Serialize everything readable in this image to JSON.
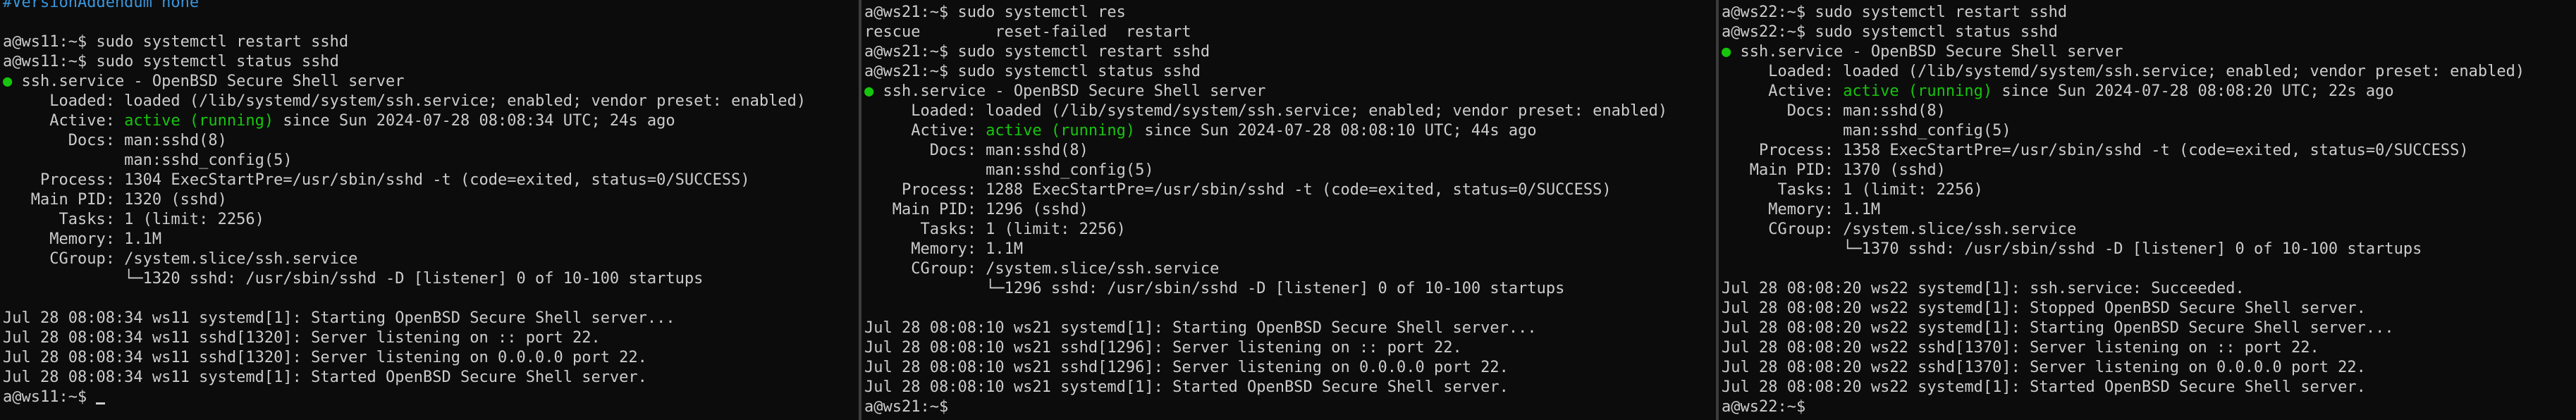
{
  "panes": [
    {
      "host": "ws11",
      "lines": [
        {
          "text": "#VersionAddendum none",
          "color": "cyan"
        },
        {
          "text": ""
        },
        {
          "text": "a@ws11:~$ sudo systemctl restart sshd"
        },
        {
          "text": "a@ws11:~$ sudo systemctl status sshd"
        },
        {
          "bullet": "●",
          "text": " ssh.service - OpenBSD Secure Shell server"
        },
        {
          "text": "     Loaded: loaded (/lib/systemd/system/ssh.service; enabled; vendor preset: enabled)"
        },
        {
          "pre": "     Active: ",
          "hl": "active (running)",
          "post": " since Sun 2024-07-28 08:08:34 UTC; 24s ago"
        },
        {
          "text": "       Docs: man:sshd(8)"
        },
        {
          "text": "             man:sshd_config(5)"
        },
        {
          "text": "    Process: 1304 ExecStartPre=/usr/sbin/sshd -t (code=exited, status=0/SUCCESS)"
        },
        {
          "text": "   Main PID: 1320 (sshd)"
        },
        {
          "text": "      Tasks: 1 (limit: 2256)"
        },
        {
          "text": "     Memory: 1.1M"
        },
        {
          "text": "     CGroup: /system.slice/ssh.service"
        },
        {
          "text": "             └─1320 sshd: /usr/sbin/sshd -D [listener] 0 of 10-100 startups"
        },
        {
          "text": ""
        },
        {
          "text": "Jul 28 08:08:34 ws11 systemd[1]: Starting OpenBSD Secure Shell server..."
        },
        {
          "text": "Jul 28 08:08:34 ws11 sshd[1320]: Server listening on :: port 22."
        },
        {
          "text": "Jul 28 08:08:34 ws11 sshd[1320]: Server listening on 0.0.0.0 port 22."
        },
        {
          "text": "Jul 28 08:08:34 ws11 systemd[1]: Started OpenBSD Secure Shell server."
        },
        {
          "text": "a@ws11:~$ ",
          "cursor": true
        }
      ]
    },
    {
      "host": "ws21",
      "lines": [
        {
          "text": "a@ws21:~$ sudo systemctl res"
        },
        {
          "text": "rescue        reset-failed  restart"
        },
        {
          "text": "a@ws21:~$ sudo systemctl restart sshd"
        },
        {
          "text": "a@ws21:~$ sudo systemctl status sshd"
        },
        {
          "bullet": "●",
          "text": " ssh.service - OpenBSD Secure Shell server"
        },
        {
          "text": "     Loaded: loaded (/lib/systemd/system/ssh.service; enabled; vendor preset: enabled)"
        },
        {
          "pre": "     Active: ",
          "hl": "active (running)",
          "post": " since Sun 2024-07-28 08:08:10 UTC; 44s ago"
        },
        {
          "text": "       Docs: man:sshd(8)"
        },
        {
          "text": "             man:sshd_config(5)"
        },
        {
          "text": "    Process: 1288 ExecStartPre=/usr/sbin/sshd -t (code=exited, status=0/SUCCESS)"
        },
        {
          "text": "   Main PID: 1296 (sshd)"
        },
        {
          "text": "      Tasks: 1 (limit: 2256)"
        },
        {
          "text": "     Memory: 1.1M"
        },
        {
          "text": "     CGroup: /system.slice/ssh.service"
        },
        {
          "text": "             └─1296 sshd: /usr/sbin/sshd -D [listener] 0 of 10-100 startups"
        },
        {
          "text": ""
        },
        {
          "text": "Jul 28 08:08:10 ws21 systemd[1]: Starting OpenBSD Secure Shell server..."
        },
        {
          "text": "Jul 28 08:08:10 ws21 sshd[1296]: Server listening on :: port 22."
        },
        {
          "text": "Jul 28 08:08:10 ws21 sshd[1296]: Server listening on 0.0.0.0 port 22."
        },
        {
          "text": "Jul 28 08:08:10 ws21 systemd[1]: Started OpenBSD Secure Shell server."
        },
        {
          "text": "a@ws21:~$ "
        }
      ]
    },
    {
      "host": "ws22",
      "lines": [
        {
          "text": "a@ws22:~$ sudo systemctl restart sshd"
        },
        {
          "text": "a@ws22:~$ sudo systemctl status sshd"
        },
        {
          "bullet": "●",
          "text": " ssh.service - OpenBSD Secure Shell server"
        },
        {
          "text": "     Loaded: loaded (/lib/systemd/system/ssh.service; enabled; vendor preset: enabled)"
        },
        {
          "pre": "     Active: ",
          "hl": "active (running)",
          "post": " since Sun 2024-07-28 08:08:20 UTC; 22s ago"
        },
        {
          "text": "       Docs: man:sshd(8)"
        },
        {
          "text": "             man:sshd_config(5)"
        },
        {
          "text": "    Process: 1358 ExecStartPre=/usr/sbin/sshd -t (code=exited, status=0/SUCCESS)"
        },
        {
          "text": "   Main PID: 1370 (sshd)"
        },
        {
          "text": "      Tasks: 1 (limit: 2256)"
        },
        {
          "text": "     Memory: 1.1M"
        },
        {
          "text": "     CGroup: /system.slice/ssh.service"
        },
        {
          "text": "             └─1370 sshd: /usr/sbin/sshd -D [listener] 0 of 10-100 startups"
        },
        {
          "text": ""
        },
        {
          "text": "Jul 28 08:08:20 ws22 systemd[1]: ssh.service: Succeeded."
        },
        {
          "text": "Jul 28 08:08:20 ws22 systemd[1]: Stopped OpenBSD Secure Shell server."
        },
        {
          "text": "Jul 28 08:08:20 ws22 systemd[1]: Starting OpenBSD Secure Shell server..."
        },
        {
          "text": "Jul 28 08:08:20 ws22 sshd[1370]: Server listening on :: port 22."
        },
        {
          "text": "Jul 28 08:08:20 ws22 sshd[1370]: Server listening on 0.0.0.0 port 22."
        },
        {
          "text": "Jul 28 08:08:20 ws22 systemd[1]: Started OpenBSD Secure Shell server."
        },
        {
          "text": "a@ws22:~$ "
        }
      ]
    }
  ],
  "colors": {
    "text": "#cccccc",
    "green": "#16c60c",
    "cyan": "#3a96dd",
    "background": "#0c0c0c"
  }
}
